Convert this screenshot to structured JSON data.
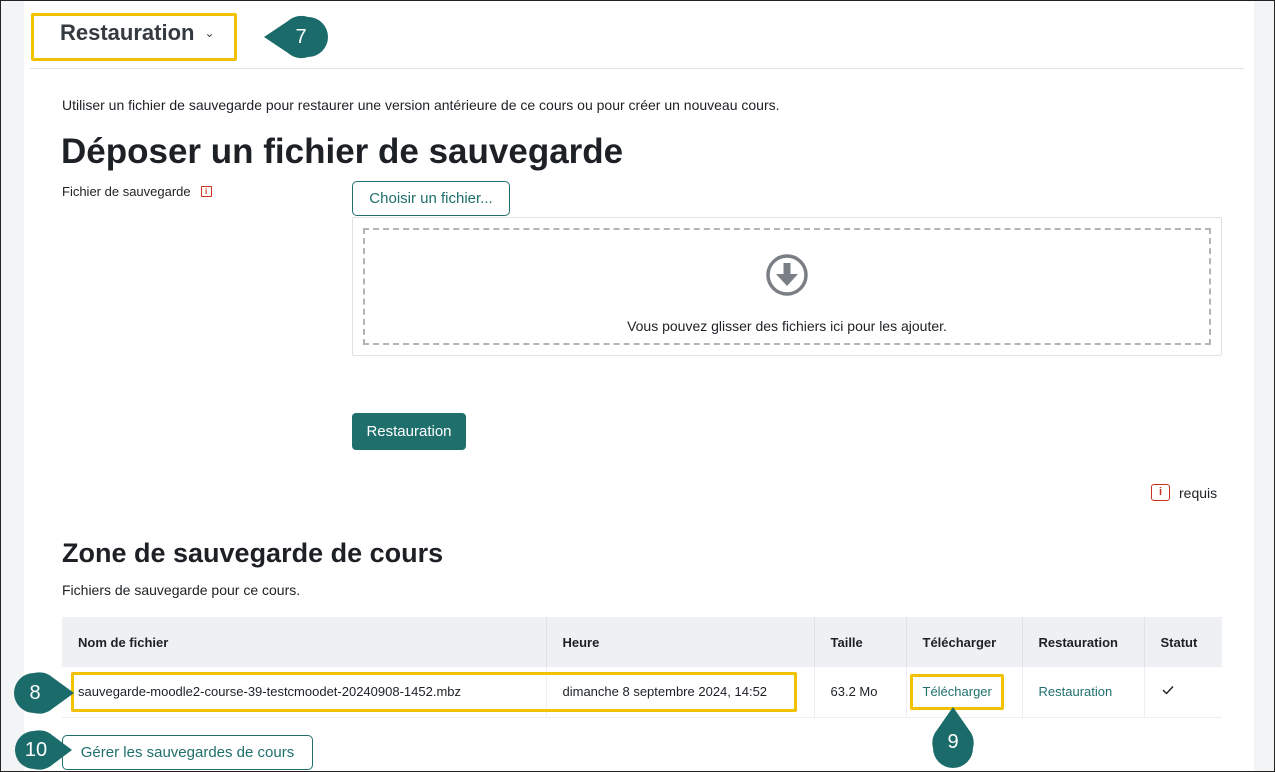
{
  "header": {
    "title": "Restauration",
    "chevron_icon": "chevron-down-icon"
  },
  "intro": "Utiliser un fichier de sauvegarde pour restaurer une version antérieure de ce cours ou pour créer un nouveau cours.",
  "deposit": {
    "heading": "Déposer un fichier de sauvegarde",
    "field_label": "Fichier de sauvegarde",
    "choose_button": "Choisir un fichier...",
    "dropzone_text": "Vous pouvez glisser des fichiers ici pour les ajouter.",
    "dropzone_icon": "download-arrow-icon",
    "restore_button": "Restauration",
    "required_legend": "requis",
    "required_icon_glyph": "i"
  },
  "zone": {
    "heading": "Zone de sauvegarde de cours",
    "subtitle": "Fichiers de sauvegarde pour ce cours.",
    "columns": [
      "Nom de fichier",
      "Heure",
      "Taille",
      "Télécharger",
      "Restauration",
      "Statut"
    ],
    "rows": [
      {
        "filename": "sauvegarde-moodle2-course-39-testcmoodet-20240908-1452.mbz",
        "time": "dimanche 8 septembre 2024, 14:52",
        "size": "63.2 Mo",
        "download": "Télécharger",
        "restore": "Restauration",
        "status_icon": "check-icon"
      }
    ],
    "manage_button": "Gérer les sauvegardes de cours"
  },
  "callouts": {
    "c7": "7",
    "c8": "8",
    "c9": "9",
    "c10": "10"
  },
  "colors": {
    "accent": "#1f6f6d",
    "highlight": "#f2c100",
    "callout": "#1a6b6a",
    "required": "#ca3120"
  }
}
